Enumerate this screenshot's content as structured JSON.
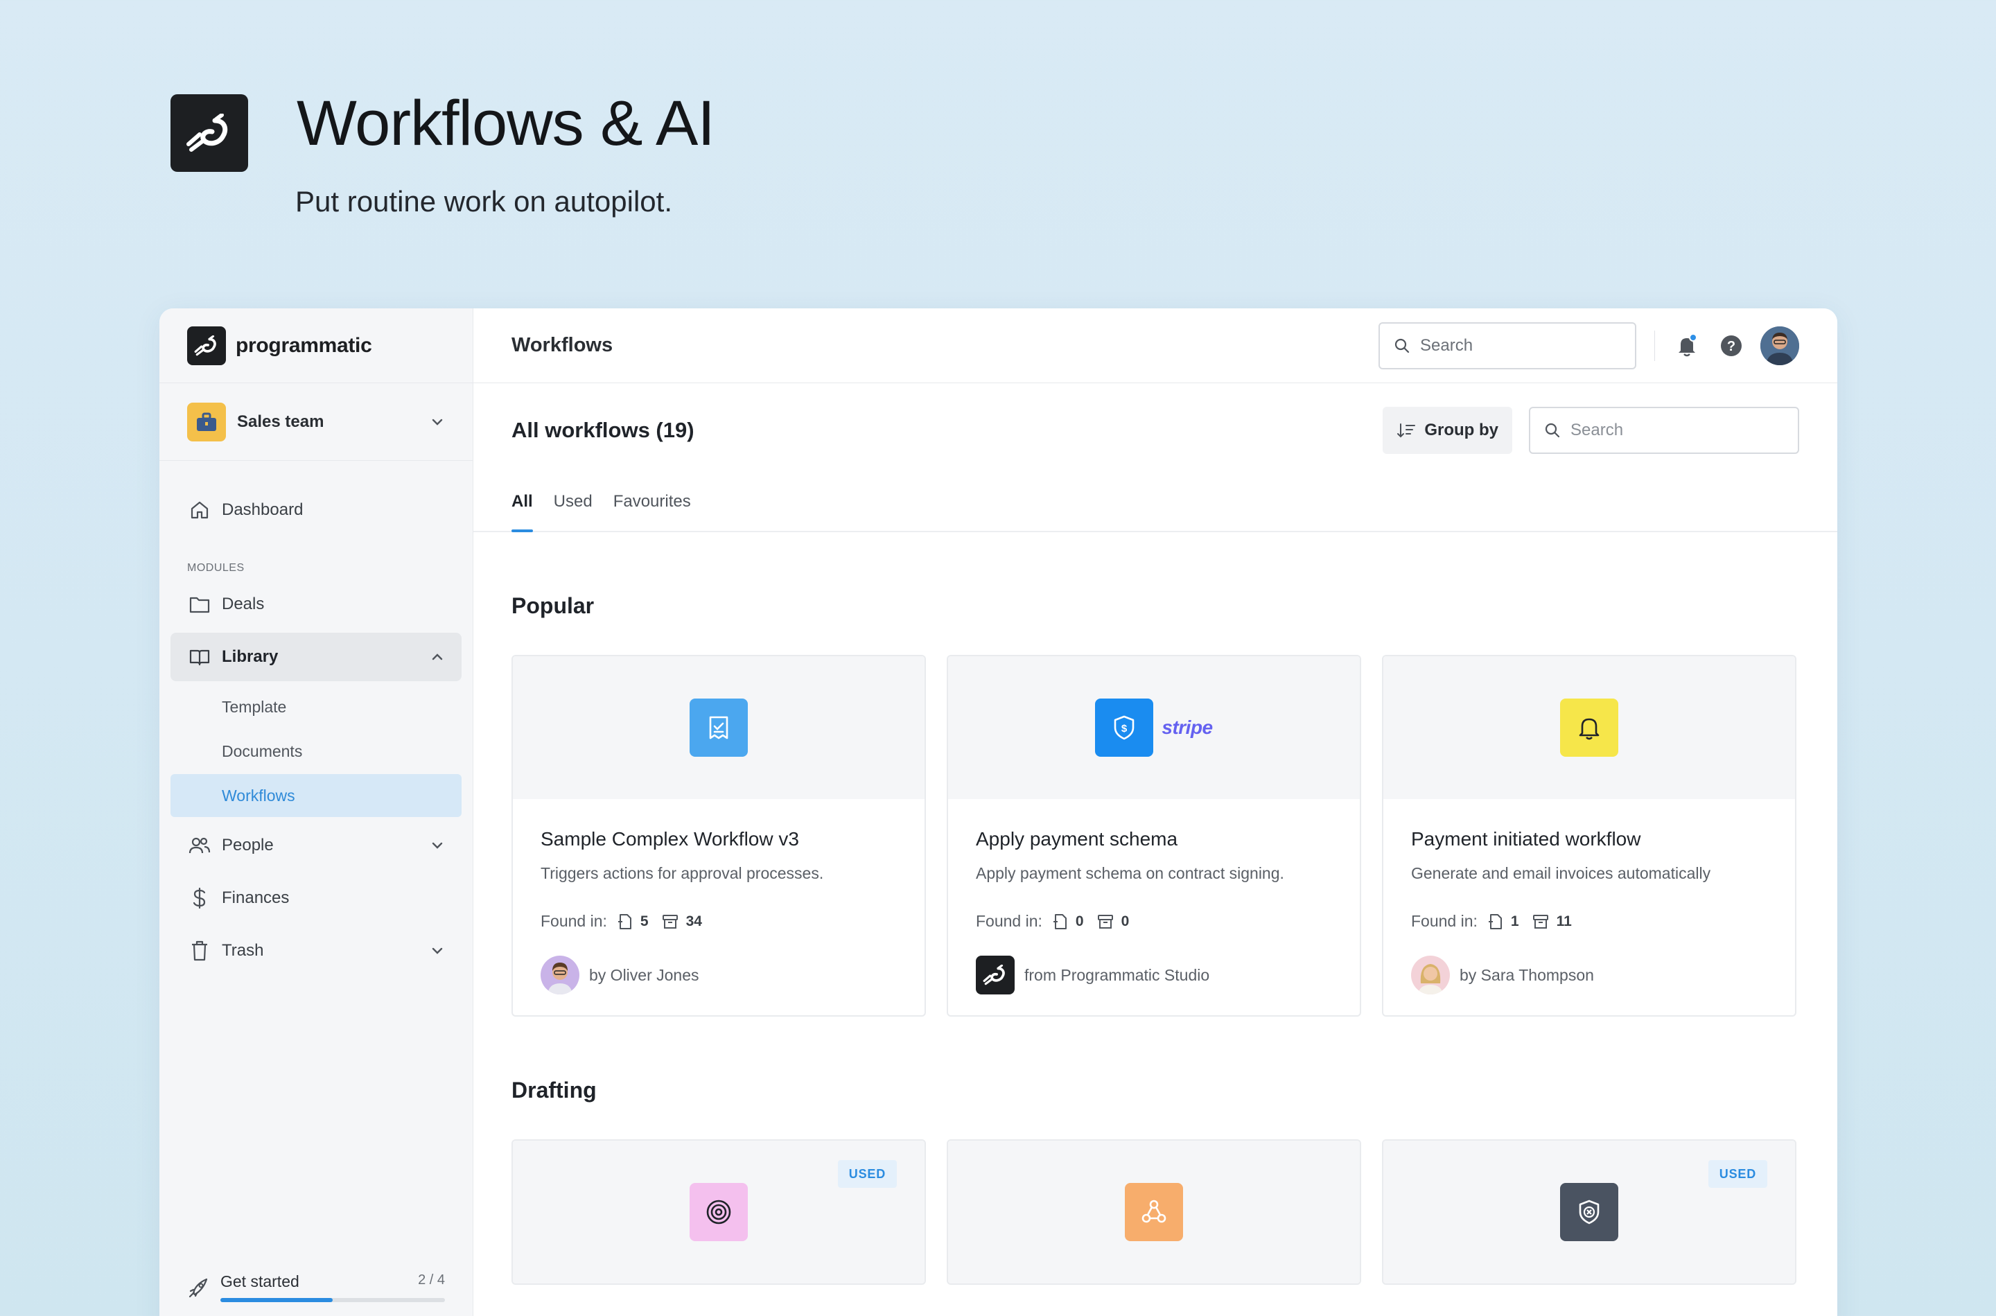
{
  "hero": {
    "title": "Workflows & AI",
    "subtitle": "Put routine work on autopilot."
  },
  "brand": {
    "name": "programmatic"
  },
  "team": {
    "name": "Sales team"
  },
  "nav": {
    "dashboard": "Dashboard",
    "modules_label": "MODULES",
    "deals": "Deals",
    "library": "Library",
    "library_children": [
      "Template",
      "Documents",
      "Workflows"
    ],
    "people": "People",
    "finances": "Finances",
    "trash": "Trash"
  },
  "get_started": {
    "label": "Get started",
    "count": "2 / 4",
    "progress": 0.5
  },
  "topbar": {
    "title": "Workflows",
    "search_placeholder": "Search"
  },
  "header": {
    "title": "All workflows (19)",
    "group_by": "Group by",
    "search_placeholder": "Search"
  },
  "tabs": [
    "All",
    "Used",
    "Favourites"
  ],
  "active_tab": "All",
  "popular": {
    "title": "Popular",
    "cards": [
      {
        "title": "Sample Complex Workflow v3",
        "description": "Triggers actions for approval processes.",
        "found_label": "Found in:",
        "docs": "5",
        "archives": "34",
        "author": "by Oliver Jones",
        "icon": "receipt-check-icon",
        "icon_bg": "#4ba7ef"
      },
      {
        "title": "Apply payment schema",
        "description": "Apply payment schema on contract signing.",
        "found_label": "Found in:",
        "docs": "0",
        "archives": "0",
        "author": "from Programmatic Studio",
        "icon": "shield-dollar-icon",
        "icon_bg": "#1a8cf0",
        "brand_text": "stripe"
      },
      {
        "title": "Payment initiated workflow",
        "description": "Generate and email invoices automatically",
        "found_label": "Found in:",
        "docs": "1",
        "archives": "11",
        "author": "by Sara Thompson",
        "icon": "bell-icon",
        "icon_bg": "#f6e64a"
      }
    ]
  },
  "drafting": {
    "title": "Drafting",
    "cards": [
      {
        "icon": "target-icon",
        "icon_bg": "#f4c0ee",
        "badge": "USED"
      },
      {
        "icon": "triangle-nodes-icon",
        "icon_bg": "#f7ad6c",
        "badge": ""
      },
      {
        "icon": "shield-x-icon",
        "icon_bg": "#4a5361",
        "badge": "USED"
      }
    ]
  },
  "colors": {
    "accent": "#2b8ce0",
    "selected_bg": "#d6e8f7"
  }
}
